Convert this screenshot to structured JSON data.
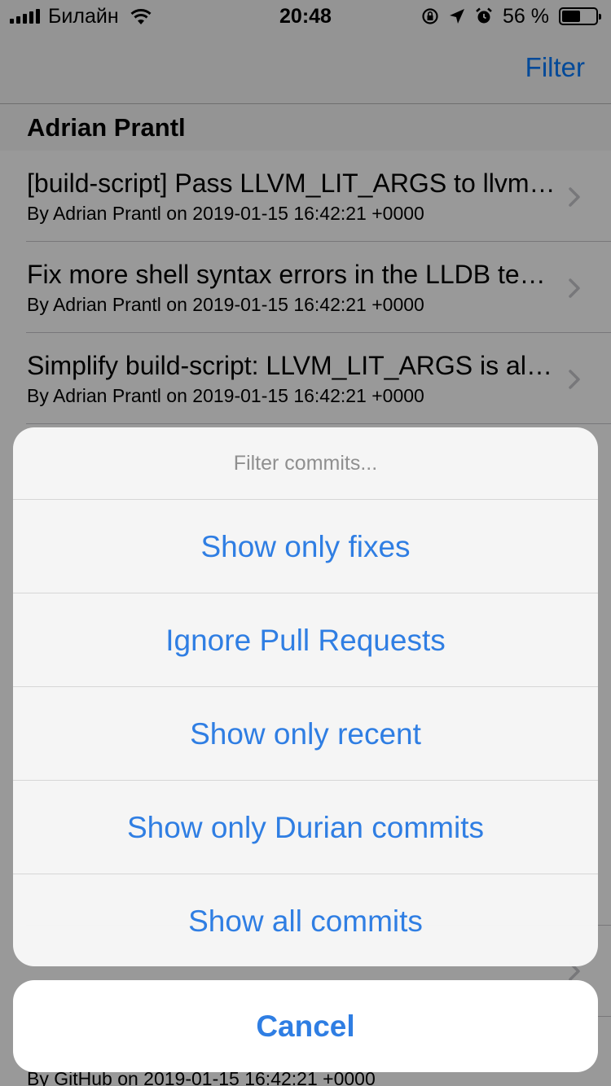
{
  "status_bar": {
    "carrier": "Билайн",
    "time": "20:48",
    "battery_percent_label": "56 %",
    "battery_level": 0.56,
    "icons": [
      "signal-icon",
      "wifi-icon",
      "rotation-lock-icon",
      "location-icon",
      "alarm-icon",
      "battery-icon"
    ]
  },
  "nav": {
    "filter_label": "Filter"
  },
  "section": {
    "title": "Adrian Prantl"
  },
  "commits": [
    {
      "title": "[build-script] Pass LLVM_LIT_ARGS to llvm-lit",
      "subtitle": "By Adrian Prantl on 2019-01-15 16:42:21 +0000"
    },
    {
      "title": "Fix more shell syntax errors in the LLDB test suite",
      "subtitle": "By Adrian Prantl on 2019-01-15 16:42:21 +0000"
    },
    {
      "title": "Simplify build-script: LLVM_LIT_ARGS is already set",
      "subtitle": "By Adrian Prantl on 2019-01-15 16:42:21 +0000"
    }
  ],
  "bottom_row": {
    "subtitle": "By GitHub on 2019-01-15 16:42:21 +0000"
  },
  "action_sheet": {
    "title": "Filter commits...",
    "options": [
      "Show only fixes",
      "Ignore Pull Requests",
      "Show only recent",
      "Show only Durian commits",
      "Show all commits"
    ],
    "cancel_label": "Cancel"
  },
  "colors": {
    "accent": "#2f7ee3",
    "ios_blue": "#007aff"
  }
}
